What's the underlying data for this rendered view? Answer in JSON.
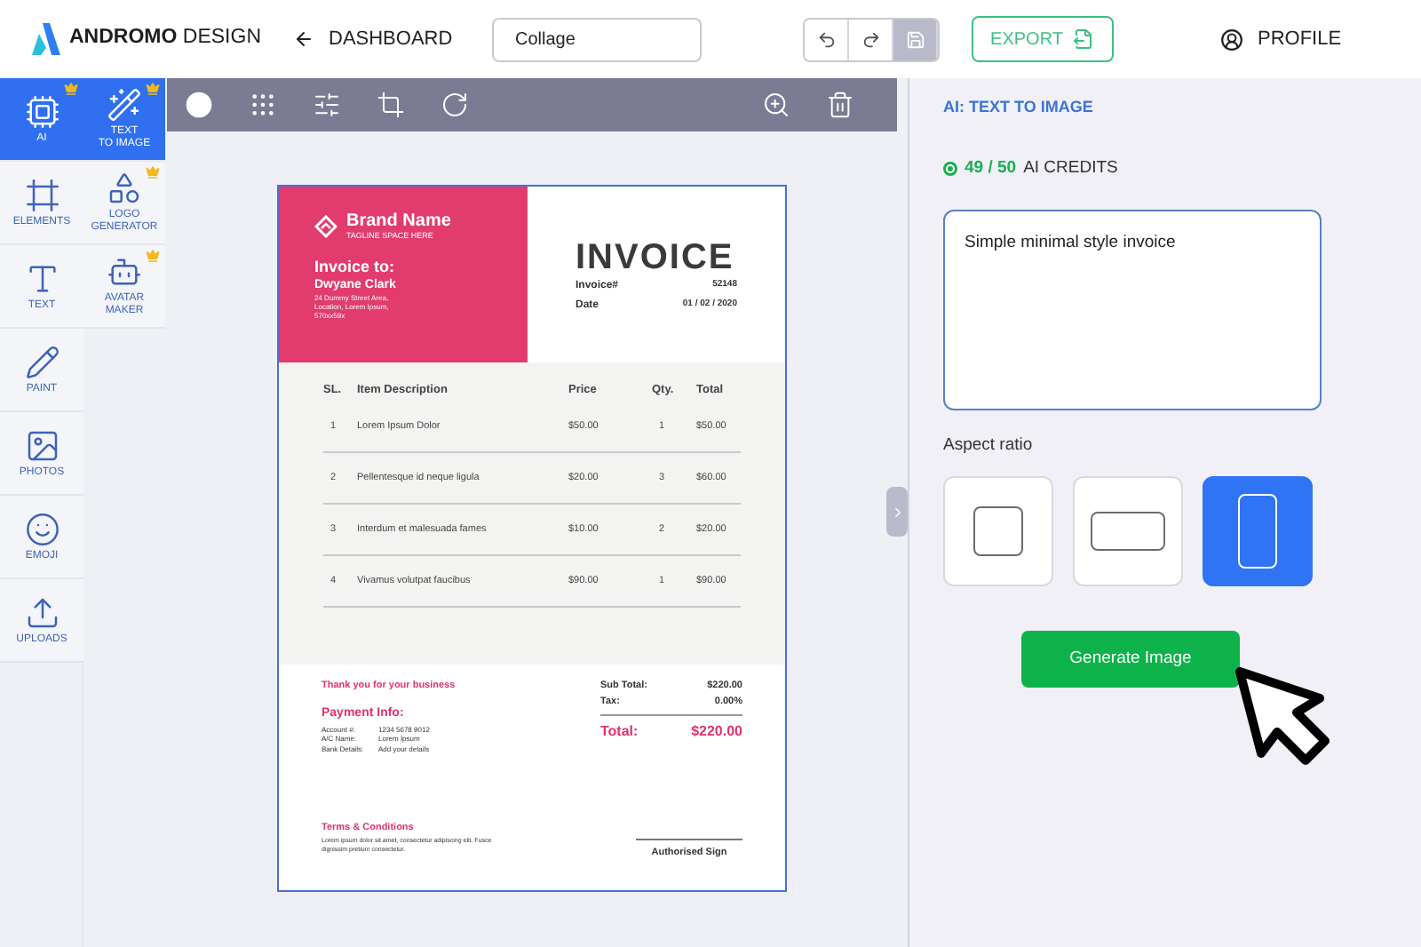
{
  "header": {
    "logo_bold": "ANDROMO",
    "logo_light": "DESIGN",
    "back": "DASHBOARD",
    "title_field": "Collage",
    "history": [
      {
        "kind": "undo",
        "disabled": false
      },
      {
        "kind": "redo",
        "disabled": false
      },
      {
        "kind": "save",
        "disabled": true
      }
    ],
    "export": "EXPORT",
    "profile": "PROFILE"
  },
  "rail": [
    {
      "label": "AI",
      "selected": true,
      "premium": true
    },
    {
      "label": "ELEMENTS",
      "selected": false,
      "premium": false
    },
    {
      "label": "TEXT",
      "selected": false,
      "premium": false
    },
    {
      "label": "PAINT",
      "selected": false,
      "premium": false
    },
    {
      "label": "PHOTOS",
      "selected": false,
      "premium": false
    },
    {
      "label": "EMOJI",
      "selected": false,
      "premium": false
    },
    {
      "label": "UPLOADS",
      "selected": false,
      "premium": false
    }
  ],
  "subtools": [
    {
      "label": "TEXT\nTO IMAGE",
      "selected": true,
      "premium": true
    },
    {
      "label": "LOGO\nGENERATOR",
      "selected": false,
      "premium": true
    },
    {
      "label": "AVATAR\nMAKER",
      "selected": false,
      "premium": true
    }
  ],
  "invoice": {
    "brand": "Brand Name",
    "tagline": "TAGLINE SPACE HERE",
    "to_label": "Invoice to:",
    "client": "Dwyane Clark",
    "address": "24 Dummy Street Area,\nLocation, Lorem Ipsum,\n570xx59x",
    "title": "INVOICE",
    "meta": [
      {
        "label": "Invoice#",
        "value": "52148"
      },
      {
        "label": "Date",
        "value": "01 / 02 / 2020"
      }
    ],
    "columns": [
      "SL.",
      "Item Description",
      "Price",
      "Qty.",
      "Total"
    ],
    "rows": [
      [
        "1",
        "Lorem Ipsum Dolor",
        "$50.00",
        "1",
        "$50.00"
      ],
      [
        "2",
        "Pellentesque id neque ligula",
        "$20.00",
        "3",
        "$60.00"
      ],
      [
        "3",
        "Interdum et malesuada fames",
        "$10.00",
        "2",
        "$20.00"
      ],
      [
        "4",
        "Vivamus volutpat faucibus",
        "$90.00",
        "1",
        "$90.00"
      ]
    ],
    "thanks": "Thank you for your business",
    "payment_title": "Payment Info:",
    "payment": [
      {
        "label": "Account #:",
        "value": "1234 5678 9012"
      },
      {
        "label": "A/C Name:",
        "value": "Lorem Ipsum"
      },
      {
        "label": "Bank Details:",
        "value": "Add your details"
      }
    ],
    "sums": [
      {
        "label": "Sub Total:",
        "value": "$220.00"
      },
      {
        "label": "Tax:",
        "value": "0.00%"
      }
    ],
    "total_label": "Total:",
    "total": "$220.00",
    "terms_title": "Terms & Conditions",
    "terms": "Lorem ipsum dolor sit amet, consectetur adipiscing elit. Fusce dignissim pretium consectetur.",
    "sign": "Authorised Sign"
  },
  "panel": {
    "title": "AI: TEXT TO IMAGE",
    "credits": "49 / 50",
    "credits_label": "AI CREDITS",
    "prompt": "Simple minimal style invoice",
    "aspect_label": "Aspect ratio",
    "aspects": [
      {
        "kind": "square",
        "selected": false
      },
      {
        "kind": "landscape",
        "selected": false
      },
      {
        "kind": "portrait",
        "selected": true
      }
    ],
    "generate": "Generate Image"
  }
}
